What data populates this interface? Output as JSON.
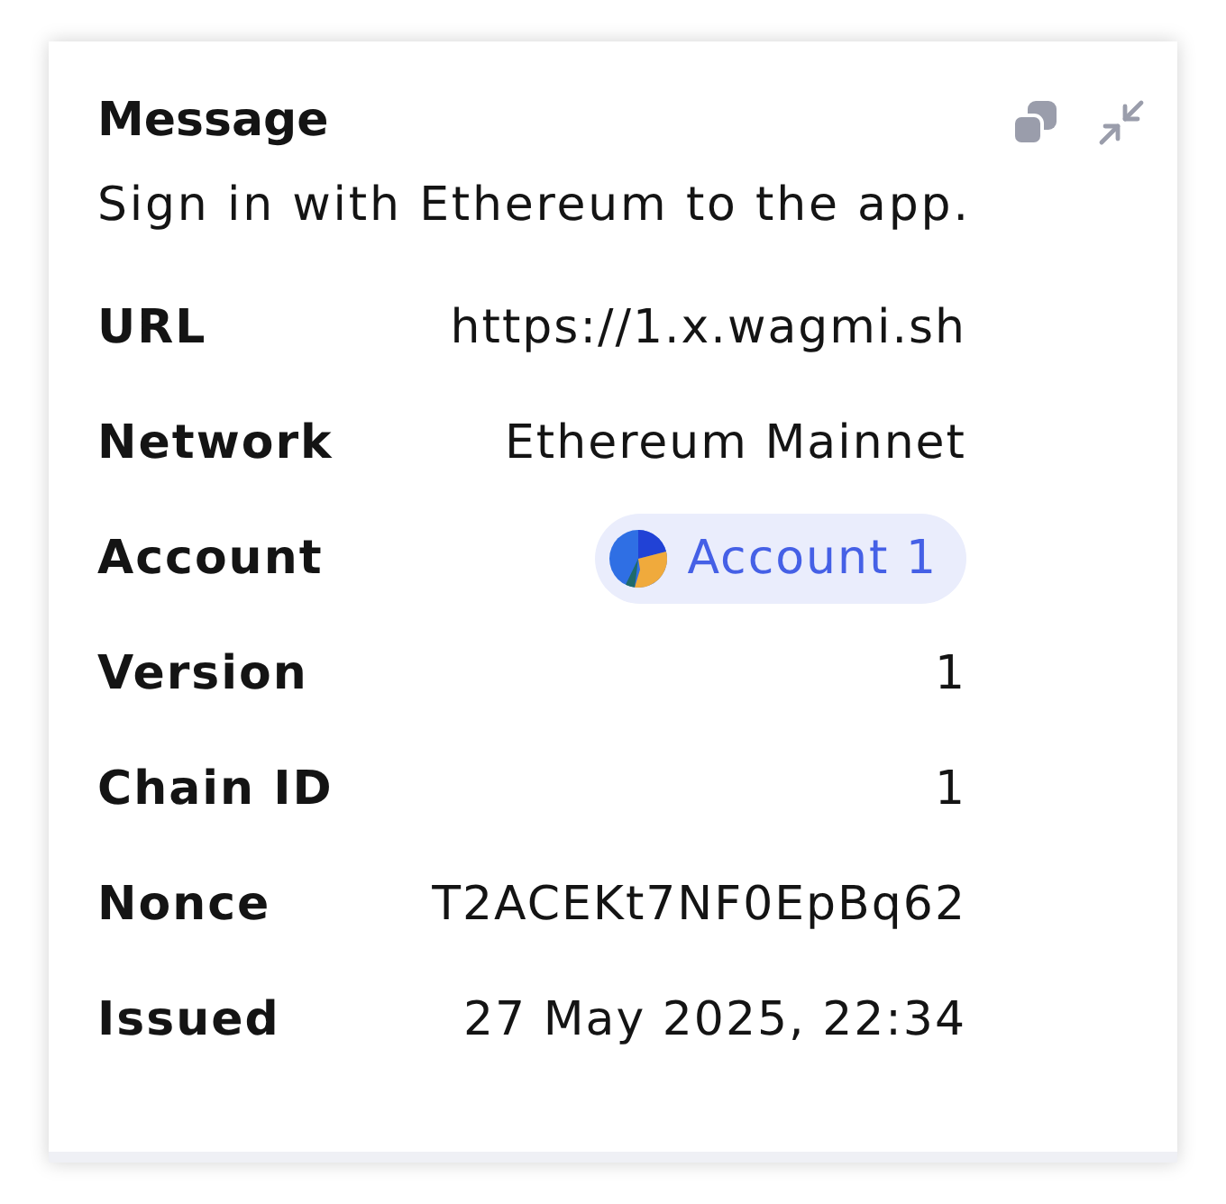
{
  "message": {
    "title": "Message",
    "text": "Sign in with Ethereum to the app."
  },
  "fields": [
    {
      "kind": "text",
      "label": "URL",
      "value": "https://1.x.wagmi.sh"
    },
    {
      "kind": "text",
      "label": "Network",
      "value": "Ethereum Mainnet"
    },
    {
      "kind": "account",
      "label": "Account",
      "value": "Account 1"
    },
    {
      "kind": "text",
      "label": "Version",
      "value": "1"
    },
    {
      "kind": "text",
      "label": "Chain ID",
      "value": "1"
    },
    {
      "kind": "text",
      "label": "Nonce",
      "value": "T2ACEKt7NF0EpBq62"
    },
    {
      "kind": "text",
      "label": "Issued",
      "value": "27 May 2025, 22:34"
    }
  ]
}
